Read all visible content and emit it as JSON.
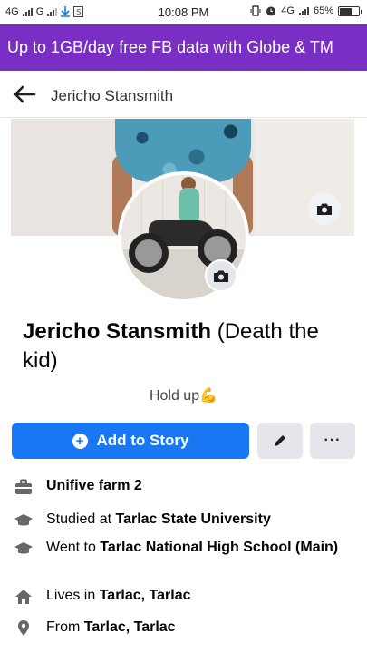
{
  "status_bar": {
    "network_left": "4G",
    "network_left2": "G",
    "time": "10:08 PM",
    "network_right": "4G",
    "battery": "65%"
  },
  "promo": {
    "text": "Up to 1GB/day free FB data with Globe & TM"
  },
  "header": {
    "title": "Jericho Stansmith"
  },
  "profile": {
    "name": "Jericho Stansmith",
    "alt_name": "(Death the kid)",
    "bio": "Hold up",
    "bio_emoji": "💪"
  },
  "actions": {
    "add_story": "Add to Story",
    "more": "···"
  },
  "details": [
    {
      "icon": "briefcase-icon",
      "prefix": "",
      "bold": "Unifive farm 2",
      "suffix": ""
    },
    {
      "icon": "graduation-cap-icon",
      "prefix": "Studied at ",
      "bold": "Tarlac State University",
      "suffix": ""
    },
    {
      "icon": "graduation-cap-icon",
      "prefix": "Went to ",
      "bold": "Tarlac National High School (Main)",
      "suffix": ""
    },
    {
      "icon": "home-icon",
      "prefix": "Lives in ",
      "bold": "Tarlac, Tarlac",
      "suffix": ""
    },
    {
      "icon": "location-pin-icon",
      "prefix": "From ",
      "bold": "Tarlac, Tarlac",
      "suffix": ""
    }
  ],
  "colors": {
    "promo_bg": "#7a2fc4",
    "primary": "#1877f2",
    "secondary_btn": "#e4e6eb"
  }
}
